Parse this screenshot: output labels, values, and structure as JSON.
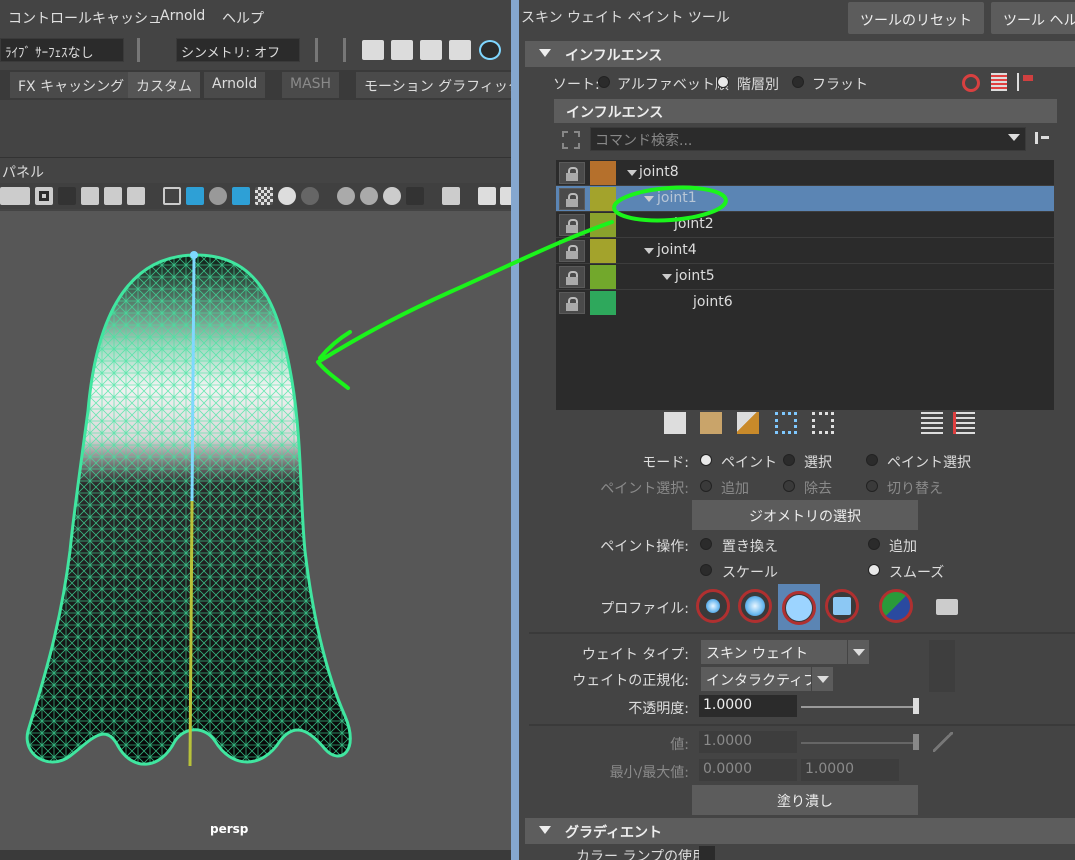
{
  "left_menu": [
    "コントロール",
    "キャッシュ",
    "Arnold",
    "ヘルプ"
  ],
  "toolbar": {
    "live_surface": "ﾗｲﾌﾞ ｻｰﾌｪｽなし",
    "symmetry": "シンメトリ: オフ"
  },
  "shelf_tabs": [
    {
      "label": "FX キャッシング",
      "state": "normal"
    },
    {
      "label": "カスタム",
      "state": "selected"
    },
    {
      "label": "Arnold",
      "state": "normal"
    },
    {
      "label": "MASH",
      "state": "dim"
    },
    {
      "label": "モーション グラフィックス",
      "state": "normal"
    }
  ],
  "panel_menu_label": "パネル",
  "viewport": {
    "camera_label": "persp",
    "annotation_color": "#1bf41b",
    "wire_color": "#40e6a0"
  },
  "tool": {
    "title": "スキン ウェイト ペイント ツール",
    "reset_button": "ツールのリセット",
    "help_button": "ツール ヘル"
  },
  "influence_section": {
    "header": "インフルエンス",
    "sort_label": "ソート:",
    "sort_options": [
      "アルファベット順",
      "階層別",
      "フラット"
    ],
    "sort_selected": "階層別",
    "list_header": "インフルエンス",
    "search_placeholder": "コマンド検索...",
    "joints": [
      {
        "name": "joint8",
        "color": "#b5702c",
        "depth": 0,
        "expanded": true,
        "selected": false
      },
      {
        "name": "joint1",
        "color": "#a3a32c",
        "depth": 1,
        "expanded": true,
        "selected": true
      },
      {
        "name": "joint2",
        "color": "#8aa22c",
        "depth": 2,
        "expanded": false,
        "selected": false
      },
      {
        "name": "joint4",
        "color": "#a3a32c",
        "depth": 1,
        "expanded": true,
        "selected": false
      },
      {
        "name": "joint5",
        "color": "#72a82c",
        "depth": 2,
        "expanded": true,
        "selected": false
      },
      {
        "name": "joint6",
        "color": "#2ea85c",
        "depth": 3,
        "expanded": false,
        "selected": false
      }
    ]
  },
  "mode": {
    "label": "モード:",
    "options": [
      "ペイント",
      "選択",
      "ペイント選択"
    ],
    "selected": "ペイント"
  },
  "paint_select": {
    "label": "ペイント選択:",
    "options": [
      "追加",
      "除去",
      "切り替え"
    ]
  },
  "geometry_button": "ジオメトリの選択",
  "paint_op": {
    "label": "ペイント操作:",
    "options": [
      "置き換え",
      "追加",
      "スケール",
      "スムーズ"
    ],
    "selected": "スムーズ"
  },
  "profile_label": "プロファイル:",
  "weight_type": {
    "label": "ウェイト タイプ:",
    "value": "スキン ウェイト"
  },
  "normalize": {
    "label": "ウェイトの正規化:",
    "value": "インタラクティブ"
  },
  "opacity": {
    "label": "不透明度:",
    "value": "1.0000",
    "level": 1.0
  },
  "value": {
    "label": "値:",
    "value": "1.0000",
    "level": 1.0
  },
  "minmax": {
    "label": "最小/最大値:",
    "min": "0.0000",
    "max": "1.0000"
  },
  "flood_button": "塗り潰し",
  "gradient": {
    "header": "グラディエント",
    "color_ramp_label": "カラー ランプの使用"
  }
}
